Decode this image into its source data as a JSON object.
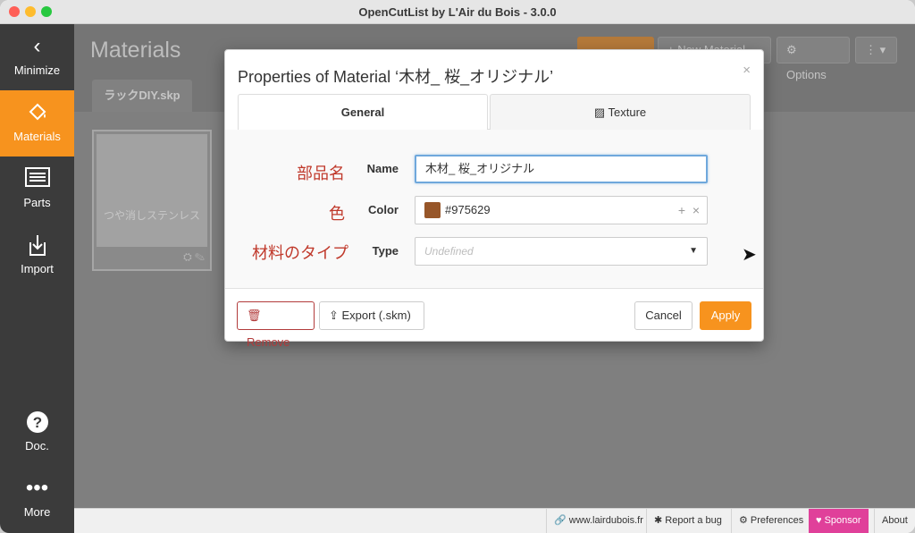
{
  "window": {
    "title": "OpenCutList by L'Air du Bois - 3.0.0"
  },
  "sidebar": {
    "items": [
      {
        "label": "Minimize",
        "icon": "chevron-left-icon"
      },
      {
        "label": "Materials",
        "icon": "paint-bucket-icon"
      },
      {
        "label": "Parts",
        "icon": "list-icon"
      },
      {
        "label": "Import",
        "icon": "import-icon"
      },
      {
        "label": "Doc.",
        "icon": "question-icon"
      },
      {
        "label": "More",
        "icon": "more-icon"
      }
    ]
  },
  "page": {
    "title": "Materials",
    "toolbar": {
      "new_material_label": "New Material",
      "options_label": "Options"
    },
    "file_tab": "ラックDIY.skp",
    "card": {
      "name": "つや消しステンレス"
    }
  },
  "modal": {
    "title": "Properties of Material ‘木材_ 桜_オリジナル’",
    "tabs": {
      "general": "General",
      "texture": "Texture"
    },
    "annotations": {
      "name": "部品名",
      "color": "色",
      "type": "材料のタイプ"
    },
    "fields": {
      "name_label": "Name",
      "name_value": "木材_ 桜_オリジナル",
      "color_label": "Color",
      "color_value": "#975629",
      "type_label": "Type",
      "type_placeholder": "Undefined"
    },
    "buttons": {
      "remove": "Remove",
      "export": "Export (.skm)",
      "cancel": "Cancel",
      "apply": "Apply"
    }
  },
  "footer": {
    "website": "www.lairdubois.fr",
    "report_bug": "Report a bug",
    "preferences": "Preferences",
    "sponsor": "Sponsor",
    "about": "About"
  },
  "colors": {
    "accent": "#f7931e",
    "sidebar": "#3b3b3b",
    "sponsor": "#e0409a",
    "remove": "#b23b3b",
    "material_color": "#975629"
  }
}
